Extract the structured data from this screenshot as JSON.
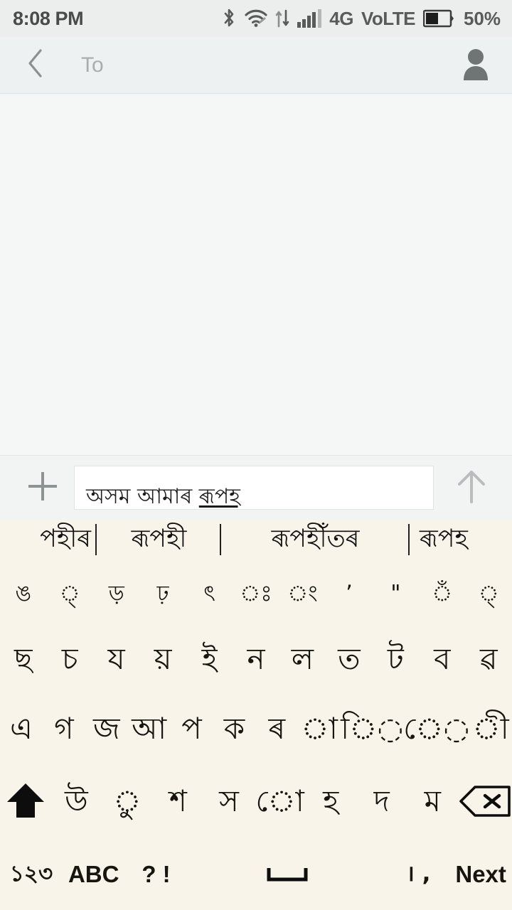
{
  "status_bar": {
    "time": "8:08 PM",
    "network_type": "4G",
    "volte_label": "VoLTE",
    "battery_percent": "50%",
    "icons": [
      "bluetooth-icon",
      "wifi-icon",
      "data-transfer-icon",
      "signal-bars-icon",
      "battery-icon"
    ]
  },
  "app_bar": {
    "back_icon": "chevron-left-icon",
    "recipient_placeholder": "To",
    "recipient_value": "",
    "contact_icon": "person-icon"
  },
  "compose": {
    "attach_icon": "plus-icon",
    "message_committed": "অসম আমাৰ ",
    "message_composing": "ৰূপহ",
    "message_full": "অসম আমাৰ ৰূপহ",
    "send_icon": "arrow-up-icon"
  },
  "keyboard": {
    "background_color": "#f8f4ea",
    "suggestions": [
      "পহীৰ",
      "ৰূপহী",
      "ৰূপহীঁতৰ",
      "ৰূপহ"
    ],
    "rows": [
      {
        "name": "row-diacritics",
        "keys": [
          {
            "label": "ঙ",
            "name": "key-nga-alt"
          },
          {
            "label": "◌্‍",
            "name": "key-hasanta-ra"
          },
          {
            "label": "ড়",
            "name": "key-rra"
          },
          {
            "label": "ঢ়",
            "name": "key-rha"
          },
          {
            "label": "ৎ",
            "name": "key-khanda-ta"
          },
          {
            "label": "◌ঃ",
            "name": "key-visarga"
          },
          {
            "label": "◌ং",
            "name": "key-anusvara"
          },
          {
            "label": "’",
            "name": "key-apostrophe"
          },
          {
            "label": "\"",
            "name": "key-quote"
          },
          {
            "label": "◌ঁ",
            "name": "key-chandrabindu"
          },
          {
            "label": "◌্",
            "name": "key-hasanta"
          }
        ]
      },
      {
        "name": "row-consonants-1",
        "keys": [
          {
            "label": "ছ",
            "name": "key-cha"
          },
          {
            "label": "চ",
            "name": "key-ca"
          },
          {
            "label": "য",
            "name": "key-ja"
          },
          {
            "label": "য়",
            "name": "key-ya"
          },
          {
            "label": "ই",
            "name": "key-i"
          },
          {
            "label": "ন",
            "name": "key-na"
          },
          {
            "label": "ল",
            "name": "key-la"
          },
          {
            "label": "ত",
            "name": "key-ta"
          },
          {
            "label": "ট",
            "name": "key-tta"
          },
          {
            "label": "ব",
            "name": "key-ba"
          },
          {
            "label": "ৱ",
            "name": "key-wa"
          }
        ]
      },
      {
        "name": "row-consonants-2",
        "keys": [
          {
            "label": "এ",
            "name": "key-e"
          },
          {
            "label": "গ",
            "name": "key-ga"
          },
          {
            "label": "জ",
            "name": "key-jha"
          },
          {
            "label": "আ",
            "name": "key-aa"
          },
          {
            "label": "প",
            "name": "key-pa"
          },
          {
            "label": "ক",
            "name": "key-ka"
          },
          {
            "label": "ৰ",
            "name": "key-ra"
          },
          {
            "label": "◌া",
            "name": "key-aa-kar"
          },
          {
            "label": "ি◌",
            "name": "key-i-kar"
          },
          {
            "label": "ে◌",
            "name": "key-e-kar"
          },
          {
            "label": "◌ী",
            "name": "key-ii-kar"
          }
        ]
      },
      {
        "name": "row-shift-consonants",
        "keys": [
          {
            "label": "",
            "name": "key-shift",
            "icon": "shift-arrow-icon"
          },
          {
            "label": "উ",
            "name": "key-u"
          },
          {
            "label": "◌ু",
            "name": "key-u-kar"
          },
          {
            "label": "শ",
            "name": "key-sha"
          },
          {
            "label": "স",
            "name": "key-sa"
          },
          {
            "label": "ো",
            "name": "key-o-kar"
          },
          {
            "label": "হ",
            "name": "key-ha"
          },
          {
            "label": "দ",
            "name": "key-da"
          },
          {
            "label": "ম",
            "name": "key-ma"
          },
          {
            "label": "",
            "name": "key-backspace",
            "icon": "backspace-icon"
          }
        ]
      },
      {
        "name": "row-bottom",
        "keys": [
          {
            "label": "১২৩",
            "name": "key-numeric-mode"
          },
          {
            "label": "ABC",
            "name": "key-latin-mode"
          },
          {
            "label": "? !",
            "name": "key-punctuation"
          },
          {
            "label": "",
            "name": "key-space",
            "icon": "space-bar-icon"
          },
          {
            "label": "। ,",
            "name": "key-danda-comma"
          },
          {
            "label": "Next",
            "name": "key-next"
          }
        ]
      }
    ]
  }
}
